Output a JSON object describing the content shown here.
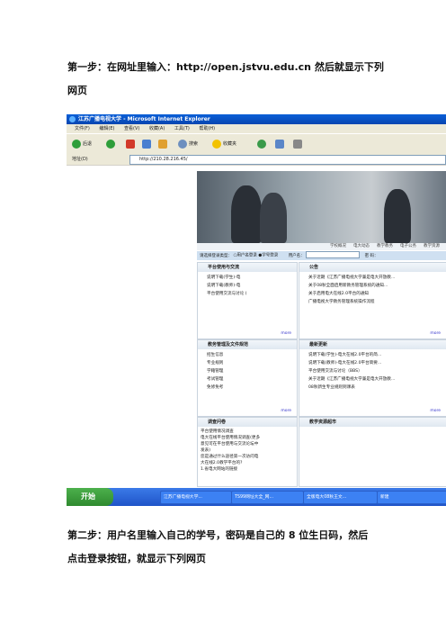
{
  "step1": {
    "line1": "第一步：在网址里输入：http://open.jstvu.edu.cn    然后就显示下列",
    "line2": "网页"
  },
  "screenshot": {
    "window_title": "江苏广播电视大学 - Microsoft Internet Explorer",
    "menu": [
      "文件(F)",
      "编辑(E)",
      "查看(V)",
      "收藏(A)",
      "工具(T)",
      "帮助(H)"
    ],
    "toolbar": {
      "back": "后退",
      "search": "搜索",
      "favorites": "收藏夹"
    },
    "address_label": "地址(D)",
    "address_value": "http://210.28.216.45/",
    "nav_links": [
      "学校概况",
      "电大动态",
      "教学教务",
      "电子公务",
      "教学资源"
    ],
    "login": {
      "prompt": "请选择登录类型：",
      "option_user": "用户名登录",
      "option_student": "学号登录",
      "username_label": "用户名：",
      "password_label": "密 码："
    },
    "panels": {
      "platform": {
        "title": "平台使用与交流",
        "items": [
          "说明下载(学生)-电",
          "说明下载(教师)-电",
          "平台使用交流与讨论 ("
        ],
        "more": "more"
      },
      "notice": {
        "title": "公告",
        "items": [
          "关于近期《江苏广播电视大学兼是电大开放教...",
          "关于08秋全面启用新教务管理系统的通知...",
          "关于启用电大在线2.0平台的通知",
          "广播电视大学教务管理系统操作流程"
        ],
        "more": "more"
      },
      "services": {
        "title": "教务管理及文件规范",
        "items": [
          "招生信息",
          "专业规则",
          "学籍管理",
          "考试管理",
          "免修免考"
        ],
        "more": "more"
      },
      "updates": {
        "title": "最新更新",
        "items": [
          "说明下载(学生)-电大在线2.0平台的简...",
          "说明下载(教师)-电大在线2.0平台简要...",
          "平台使用交流与讨论（BBS）",
          "关于近期《江苏广播电视大学兼是电大开放教...",
          "08秋新生专业规则到课表"
        ],
        "more": "more"
      },
      "survey": {
        "title": "调查问卷",
        "lines": [
          "平台使用情况调查",
          "电大在线平台使用情况调查(更多",
          "意见可在平台使用与交流论坛中",
          "发表)",
          "您是通过什么途径第一次访问电",
          "大在线2.0教学平台的?"
        ],
        "option": "1.省电大网站的链接"
      },
      "resources": {
        "title": "教学资源超市"
      }
    },
    "taskbar": {
      "start": "开始",
      "tasks": [
        "江苏广播电视大学...",
        "TS99网址大全_网...",
        "全版电大08秋王文...",
        "新建"
      ]
    }
  },
  "step2": {
    "line1": "第二步：用户名里输入自己的学号，密码是自己的 8 位生日码，然后",
    "line2": "点击登录按钮，就显示下列网页"
  }
}
